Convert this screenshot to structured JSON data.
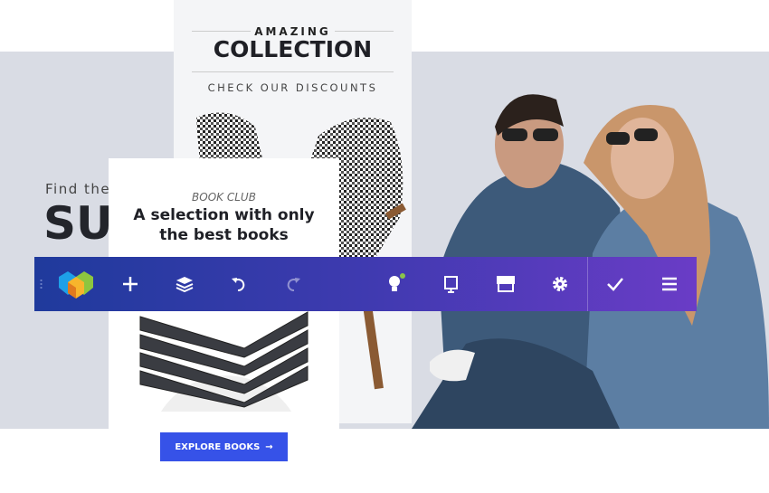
{
  "hero": {
    "subtitle": "Find the",
    "title": "SU"
  },
  "collection": {
    "eyebrow": "AMAZING",
    "title": "COLLECTION",
    "discount": "CHECK OUR DISCOUNTS"
  },
  "bookclub": {
    "eyebrow": "BOOK CLUB",
    "title": "A selection with only the best books",
    "button": "EXPLORE BOOKS",
    "button_icon": "arrow-right-icon"
  },
  "toolbar": {
    "items": [
      "logo",
      "add",
      "layers",
      "undo",
      "redo",
      "ideas",
      "desktop-preview",
      "storefront",
      "settings",
      "save",
      "menu"
    ],
    "notification_color": "#8bc34a"
  },
  "colors": {
    "toolbar_start": "#1f3a9c",
    "toolbar_end": "#6a3cc6",
    "button": "#3652e8"
  }
}
